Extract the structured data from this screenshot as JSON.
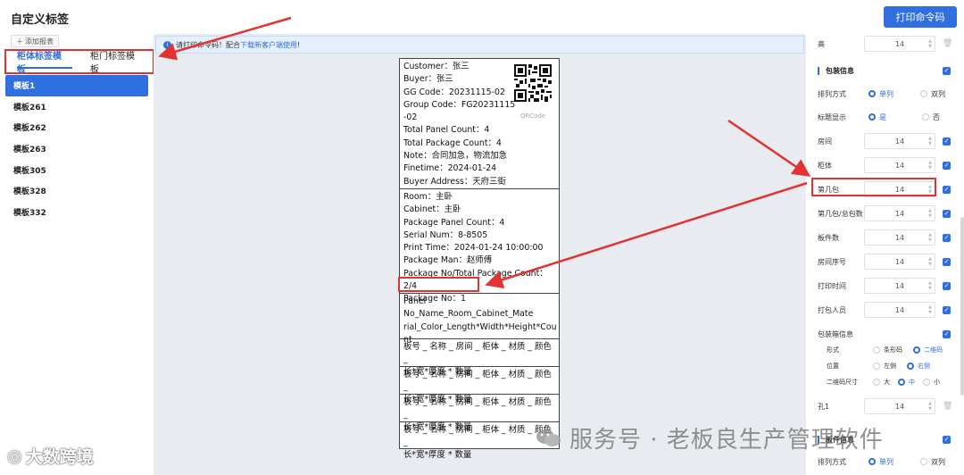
{
  "header": {
    "title": "自定义标签",
    "print_button": "打印命令码"
  },
  "left": {
    "add_report": "添加报表",
    "tabs": [
      "柜体标签模板",
      "柜门标签模板"
    ],
    "templates": [
      "模板1",
      "模板261",
      "模板262",
      "模板263",
      "模板305",
      "模板328",
      "模板332"
    ],
    "active_template": "模板1"
  },
  "notice": {
    "text": "请打印命令码！配合",
    "link": "下载新客户端使用",
    "suffix": "!"
  },
  "label": {
    "section1": [
      "Customer：张三",
      "Buyer：张三",
      "GG Code：20231115-02",
      "Group Code：FG20231115",
      "-02",
      "Total Panel Count：4",
      "Total Package Count：4",
      "Note：合同加急，物流加急",
      "Finetime：2024-01-24",
      "Buyer Address：天府三街"
    ],
    "qr_caption": "QRCode",
    "section2": [
      "Room：主卧",
      "Cabinet：主卧",
      "Package Panel Count：4",
      "Serial Num：8-8505",
      "Print Time：2024-01-24 10:00:00",
      "Package Man：赵师傅",
      "Package No/Total Package Count：2/4",
      "Package No：1"
    ],
    "section3": [
      "Panel No_Name_Room_Cabinet_Mate",
      "rial_Color_Length*Width*Height*Cou",
      "nt"
    ],
    "panel_rows": [
      [
        "板号 _ 名称 _ 房间 _ 柜体 _ 材质 _ 颜色 _",
        "长*宽*厚度 * 数量"
      ],
      [
        "板号 _ 名称 _ 房间 _ 柜体 _ 材质 _ 颜色 _",
        "长*宽*厚度 * 数量"
      ],
      [
        "板号 _ 名称 _ 房间 _ 柜体 _ 材质 _ 颜色 _",
        "长*宽*厚度 * 数量"
      ],
      [
        "板号 _ 名称 _ 房间 _ 柜体 _ 材质 _ 颜色 _",
        "长*宽*厚度 * 数量"
      ]
    ]
  },
  "right": {
    "height_label": "高",
    "height_value": "14",
    "pack_info_title": "包装信息",
    "arrange_label": "排列方式",
    "arrange_options": [
      "单列",
      "双列"
    ],
    "title_show_label": "标题显示",
    "title_show_options": [
      "是",
      "否"
    ],
    "fields": [
      {
        "label": "房间",
        "value": "14"
      },
      {
        "label": "柜体",
        "value": "14"
      },
      {
        "label": "第几包",
        "value": "14"
      },
      {
        "label": "第几包/总包数",
        "value": "14"
      },
      {
        "label": "板件数",
        "value": "14"
      },
      {
        "label": "房间序号",
        "value": "14"
      },
      {
        "label": "打印时间",
        "value": "14"
      },
      {
        "label": "打包人员",
        "value": "14"
      }
    ],
    "box_info_label": "包装箱信息",
    "form_label": "形式",
    "form_options": [
      "条形码",
      "二维码"
    ],
    "position_label": "位置",
    "position_options": [
      "左侧",
      "右侧"
    ],
    "qr_size_label": "二维码尺寸",
    "qr_size_options": [
      "大",
      "中",
      "小"
    ],
    "hole_label": "孔1",
    "hole_value": "14",
    "panel_info_title": "板件信息",
    "arrange2_label": "排列方式",
    "arrange2_options": [
      "单列",
      "双列"
    ]
  },
  "watermark": {
    "left": "大数跨境",
    "right": "服务号 · 老板良生产管理软件"
  },
  "colors": {
    "accent": "#2f6fe0",
    "annotation": "#e23232"
  }
}
